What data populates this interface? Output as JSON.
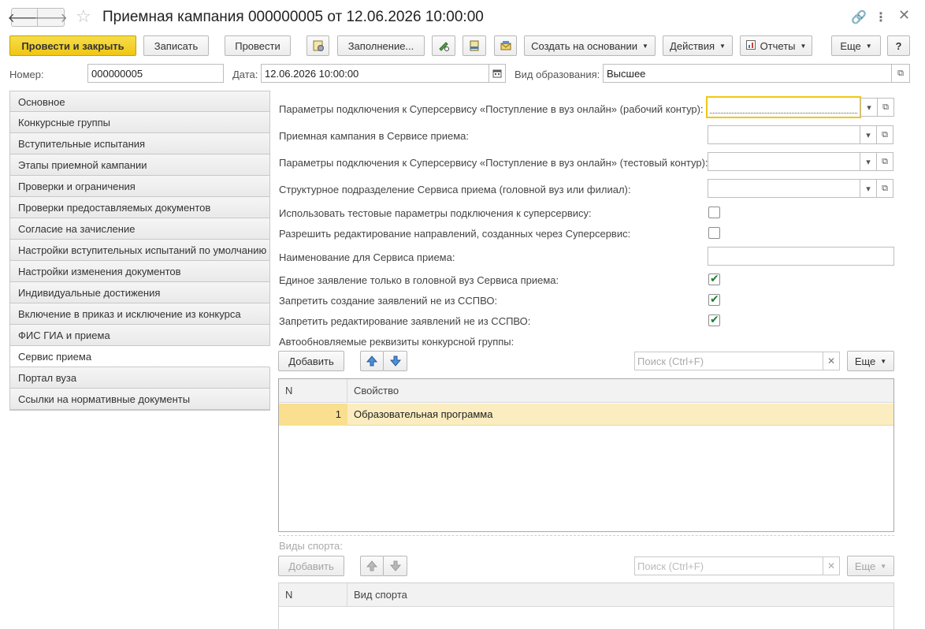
{
  "window": {
    "title": "Приемная кампания 000000005 от 12.06.2026 10:00:00"
  },
  "toolbar": {
    "post_close": "Провести и закрыть",
    "save": "Записать",
    "post": "Провести",
    "fill": "Заполнение...",
    "create_based_on": "Создать на основании",
    "actions": "Действия",
    "reports": "Отчеты",
    "more": "Еще",
    "help": "?"
  },
  "header": {
    "number_label": "Номер:",
    "number_value": "000000005",
    "date_label": "Дата:",
    "date_value": "12.06.2026 10:00:00",
    "edu_type_label": "Вид образования:",
    "edu_type_value": "Высшее"
  },
  "tabs": [
    {
      "label": "Основное"
    },
    {
      "label": "Конкурсные группы"
    },
    {
      "label": "Вступительные испытания"
    },
    {
      "label": "Этапы приемной кампании"
    },
    {
      "label": "Проверки и ограничения"
    },
    {
      "label": "Проверки предоставляемых документов"
    },
    {
      "label": "Согласие на зачисление"
    },
    {
      "label": "Настройки вступительных испытаний по умолчанию"
    },
    {
      "label": "Настройки изменения документов"
    },
    {
      "label": "Индивидуальные достижения"
    },
    {
      "label": "Включение в приказ и исключение из конкурса"
    },
    {
      "label": "ФИС ГИА и приема"
    },
    {
      "label": "Сервис приема",
      "active": true
    },
    {
      "label": "Портал вуза"
    },
    {
      "label": "Ссылки на нормативные документы"
    }
  ],
  "form": {
    "conn_work_label": "Параметры подключения к Суперсервису «Поступление в вуз онлайн» (рабочий контур):",
    "conn_work_value": "",
    "campaign_label": "Приемная кампания в Сервисе приема:",
    "campaign_value": "",
    "conn_test_label": "Параметры подключения к Суперсервису «Поступление в вуз онлайн» (тестовый контур):",
    "conn_test_value": "",
    "division_label": "Структурное подразделение Сервиса приема (головной вуз или филиал):",
    "division_value": "",
    "use_test_label": "Использовать тестовые параметры подключения к суперсервису:",
    "use_test_checked": false,
    "allow_edit_label": "Разрешить редактирование направлений, созданных через Суперсервис:",
    "allow_edit_checked": false,
    "service_name_label": "Наименование для Сервиса приема:",
    "service_name_value": "",
    "single_app_label": "Единое заявление только в головной вуз Сервиса приема:",
    "single_app_checked": true,
    "forbid_create_label": "Запретить создание заявлений не из ССПВО:",
    "forbid_create_checked": true,
    "forbid_edit_label": "Запретить редактирование заявлений не из ССПВО:",
    "forbid_edit_checked": true
  },
  "auto_props": {
    "section_label": "Автообновляемые реквизиты конкурсной группы:",
    "add_button": "Добавить",
    "search_placeholder": "Поиск (Ctrl+F)",
    "more_button": "Еще",
    "columns": [
      "N",
      "Свойство"
    ],
    "rows": [
      {
        "n": "1",
        "property": "Образовательная программа"
      }
    ]
  },
  "sports": {
    "section_label": "Виды спорта:",
    "add_button": "Добавить",
    "search_placeholder": "Поиск (Ctrl+F)",
    "more_button": "Еще",
    "columns": [
      "N",
      "Вид спорта"
    ],
    "rows": []
  },
  "colors": {
    "primary_button": "#f0c613",
    "active_row": "#fbedc0",
    "checkbox_green": "#1f7e32"
  }
}
